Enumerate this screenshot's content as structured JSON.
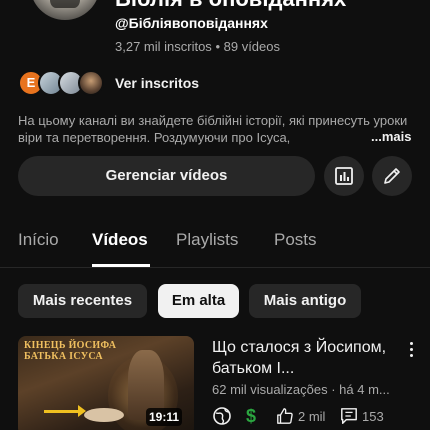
{
  "channel": {
    "title": "Біблія в оповіданнях",
    "handle": "@Бібліявоповіданнях",
    "subscribers": "3,27 mil inscritos",
    "separator": "•",
    "video_count": "89 vídeos",
    "see_subscribers": "Ver inscritos",
    "subscriber_avatar_initial": "E",
    "description": "На цьому каналі ви знайдете біблійні історії, які принесуть уроки віри та перетворення. Роздумуючи про Ісуса,",
    "more_label": "...mais"
  },
  "actions": {
    "manage_videos": "Gerenciar vídeos"
  },
  "tabs": [
    {
      "label": "Início"
    },
    {
      "label": "Vídeos",
      "selected": true
    },
    {
      "label": "Playlists"
    },
    {
      "label": "Posts"
    }
  ],
  "chips": [
    {
      "label": "Mais recentes"
    },
    {
      "label": "Em alta",
      "selected": true
    },
    {
      "label": "Mais antigo"
    }
  ],
  "video": {
    "title": "Що сталося з Йосипом, батьком І...",
    "meta": "62 mil visualizações · há 4 m...",
    "duration": "19:11",
    "thumbnail_text_line1": "КІНЕЦЬ ЙОСИФА",
    "thumbnail_text_line2": "БАТЬКА ІСУСА",
    "likes": "2 mil",
    "comments": "153",
    "monetization_symbol": "$"
  },
  "colors": {
    "background": "#0f0f0f",
    "button_bg": "#272727",
    "selected_chip_bg": "#f1f1f1",
    "monetization_green": "#2ba640"
  }
}
